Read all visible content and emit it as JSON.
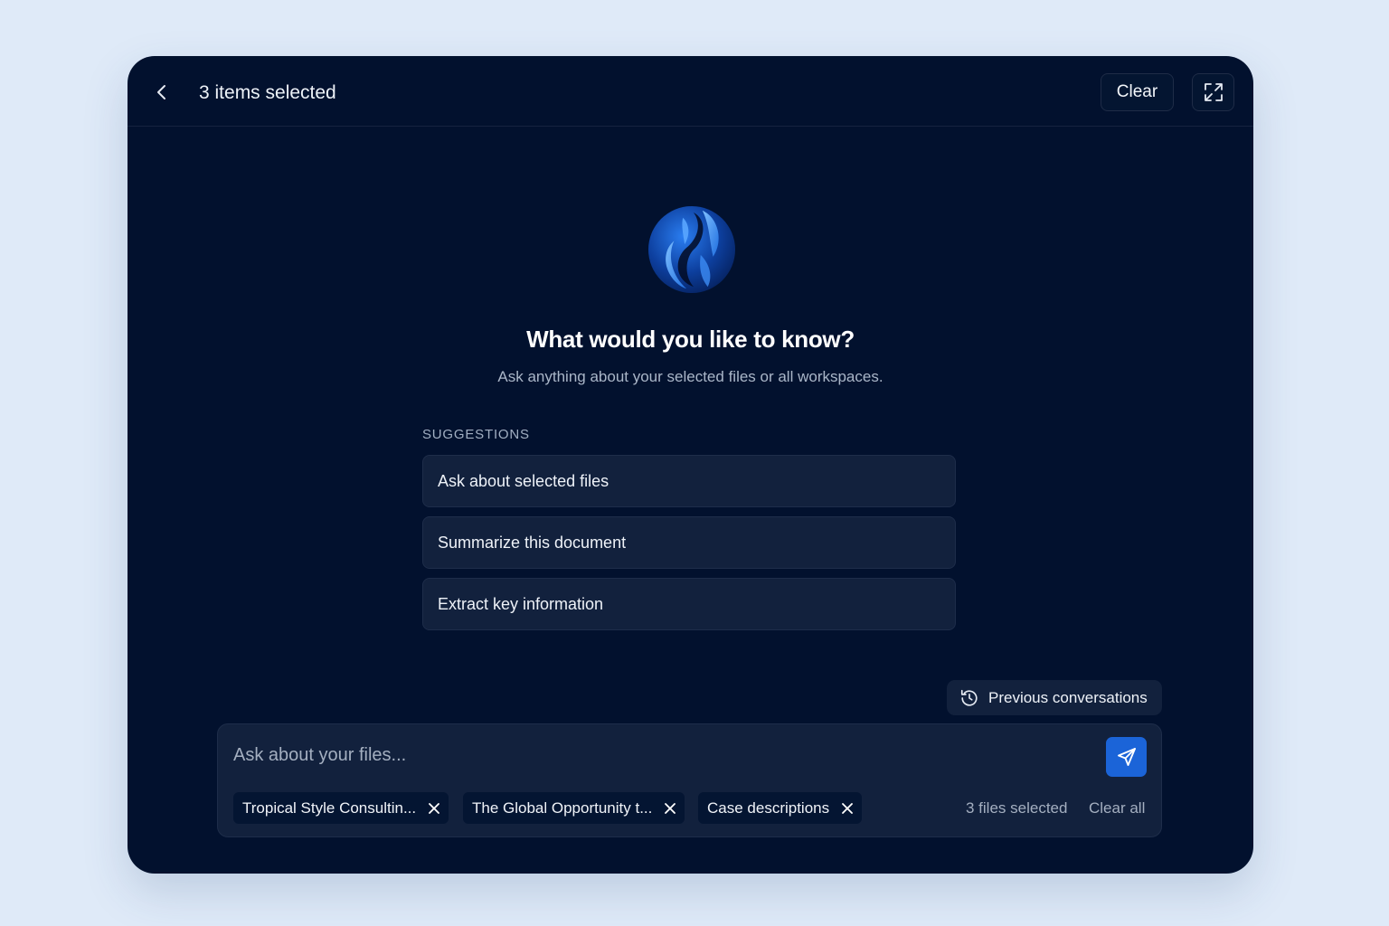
{
  "header": {
    "title": "3 items selected",
    "clear_label": "Clear"
  },
  "hero": {
    "title": "What would you like to know?",
    "subtitle": "Ask anything about your selected files or all workspaces."
  },
  "suggestions": {
    "label": "SUGGESTIONS",
    "items": [
      "Ask about selected files",
      "Summarize this document",
      "Extract key information"
    ]
  },
  "previous_conversations_label": "Previous conversations",
  "composer": {
    "placeholder": "Ask about your files...",
    "chips": [
      "Tropical Style Consultin...",
      "The Global Opportunity t...",
      "Case descriptions"
    ],
    "files_count": "3 files selected",
    "clear_all_label": "Clear all"
  },
  "icons": {
    "back": "chevron-left-icon",
    "expand": "expand-icon",
    "logo": "brand-logo",
    "history": "history-icon",
    "send": "send-icon",
    "remove": "close-icon"
  },
  "colors": {
    "page_background": "#dfeaf8",
    "panel_background": "#02112e",
    "card_background": "#12213d",
    "accent": "#1b64d8"
  }
}
